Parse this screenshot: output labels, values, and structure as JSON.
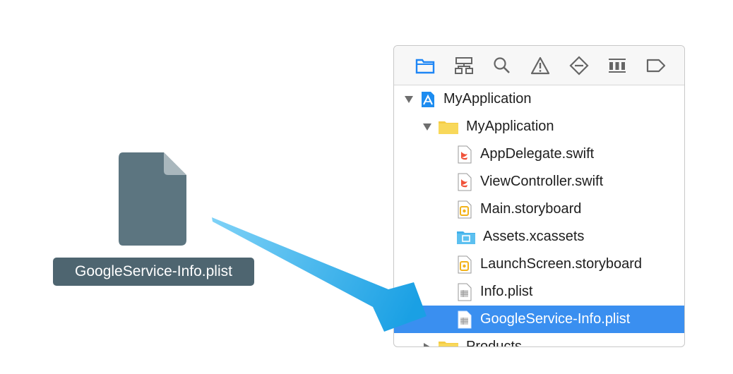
{
  "desktop_file": {
    "name": "GoogleService-Info.plist",
    "icon": "document-file-icon"
  },
  "navigator": {
    "toolbar": [
      {
        "name": "project-navigator-icon",
        "active": true
      },
      {
        "name": "source-control-navigator-icon",
        "active": false
      },
      {
        "name": "find-navigator-icon",
        "active": false
      },
      {
        "name": "issue-navigator-icon",
        "active": false
      },
      {
        "name": "test-navigator-icon",
        "active": false
      },
      {
        "name": "debug-navigator-icon",
        "active": false
      },
      {
        "name": "breakpoint-navigator-icon",
        "active": false
      }
    ],
    "tree": {
      "project": "MyApplication",
      "group": "MyApplication",
      "files": [
        {
          "label": "AppDelegate.swift",
          "icon": "swift-file-icon"
        },
        {
          "label": "ViewController.swift",
          "icon": "swift-file-icon"
        },
        {
          "label": "Main.storyboard",
          "icon": "storyboard-file-icon"
        },
        {
          "label": "Assets.xcassets",
          "icon": "asset-catalog-icon"
        },
        {
          "label": "LaunchScreen.storyboard",
          "icon": "storyboard-file-icon"
        },
        {
          "label": "Info.plist",
          "icon": "plist-file-icon"
        },
        {
          "label": "GoogleService-Info.plist",
          "icon": "plist-file-icon",
          "selected": true
        }
      ],
      "next_group": "Products"
    }
  },
  "colors": {
    "selection": "#3a8ff0",
    "arrow": "#1fa6e6",
    "file_label_bg": "#4e6570",
    "folder": "#f5cc45",
    "toolbar_active": "#1e86f5"
  }
}
